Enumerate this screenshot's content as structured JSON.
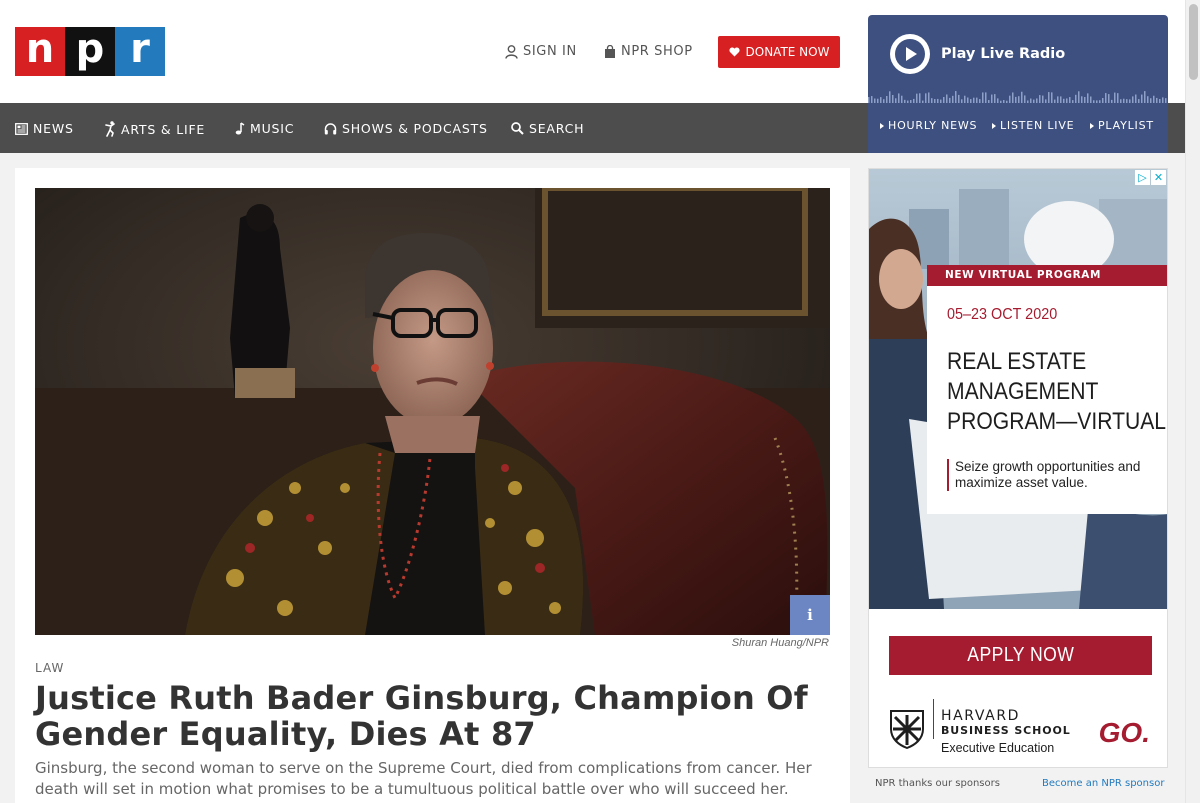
{
  "header": {
    "logo_letters": [
      "n",
      "p",
      "r"
    ],
    "sign_in": "SIGN IN",
    "shop": "NPR SHOP",
    "donate": "DONATE NOW"
  },
  "nav": {
    "items": [
      "NEWS",
      "ARTS & LIFE",
      "MUSIC",
      "SHOWS & PODCASTS",
      "SEARCH"
    ]
  },
  "player": {
    "title": "Play Live Radio",
    "links": [
      "HOURLY NEWS",
      "LISTEN LIVE",
      "PLAYLIST"
    ]
  },
  "article": {
    "credit": "Shuran Huang/NPR",
    "info_label": "i",
    "slug": "LAW",
    "headline": "Justice Ruth Bader Ginsburg, Champion Of Gender Equality, Dies At 87",
    "teaser": "Ginsburg, the second woman to serve on the Supreme Court, died from complications from cancer. Her death will set in motion what promises to be a tumultuous political battle over who will succeed her."
  },
  "ad": {
    "adchoices": "▷",
    "close": "✕",
    "tag": "NEW VIRTUAL PROGRAM",
    "date": "05–23 OCT 2020",
    "title": "REAL ESTATE MANAGEMENT PROGRAM—VIRTUAL",
    "subtitle": "Seize growth opportunities and maximize asset value.",
    "cta": "APPLY NOW",
    "brand_name": "HARVARD",
    "brand_school": "BUSINESS SCHOOL",
    "brand_exec": "Executive Education",
    "brand_go": "GO."
  },
  "sponsor": {
    "thanks": "NPR thanks our sponsors",
    "become": "Become an NPR sponsor"
  },
  "colors": {
    "npr_red": "#d62021",
    "npr_black": "#111111",
    "npr_blue": "#237bbd",
    "nav_bg": "#4d4d4d",
    "player_bg": "#3d5080",
    "hbs_crimson": "#a51c30"
  }
}
